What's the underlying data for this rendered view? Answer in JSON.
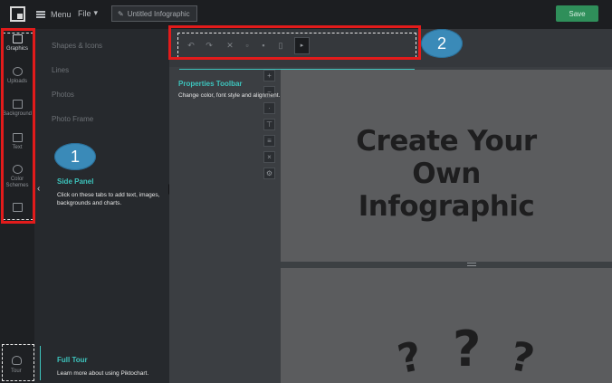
{
  "topbar": {
    "menu_label": "Menu",
    "file_label": "File",
    "title": "Untitled Infographic",
    "save_label": "Save"
  },
  "rail": {
    "items": [
      {
        "label": "Graphics",
        "icon": "image-icon"
      },
      {
        "label": "Uploads",
        "icon": "cloud-upload-icon"
      },
      {
        "label": "Background",
        "icon": "background-icon"
      },
      {
        "label": "Text",
        "icon": "text-icon"
      },
      {
        "label": "Color Schemes",
        "icon": "palette-icon"
      },
      {
        "label": "",
        "icon": "briefcase-icon"
      }
    ],
    "tour_label": "Tour"
  },
  "panel": {
    "links": [
      "Shapes & Icons",
      "Lines",
      "Photos",
      "Photo Frame"
    ]
  },
  "canvas": {
    "headline_line1": "Create Your",
    "headline_line2": "Own",
    "headline_line3": "Infographic",
    "question_marks": "?"
  },
  "annotations": {
    "badge1": "1",
    "badge2": "2",
    "side_panel_title": "Side Panel",
    "side_panel_text": "Click on these tabs to add text, images, backgrounds and charts.",
    "properties_title": "Properties Toolbar",
    "properties_text": "Change color, font style and alignment.",
    "tour_title": "Full Tour",
    "tour_text": "Learn more about using Piktochart.",
    "highlight_color": "#e21b1b",
    "accent_color": "#3dc4bd"
  }
}
